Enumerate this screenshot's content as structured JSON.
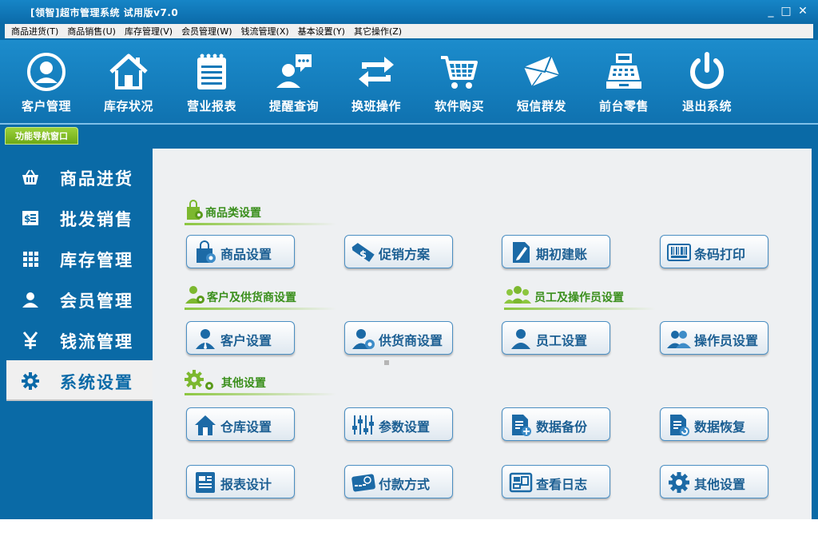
{
  "window": {
    "title": "[领智]超市管理系统 试用版v7.0",
    "minimize": "_",
    "maximize": "□",
    "close": "✕"
  },
  "menu": [
    "商品进货(T)",
    "商品销售(U)",
    "库存管理(V)",
    "会员管理(W)",
    "钱流管理(X)",
    "基本设置(Y)",
    "其它操作(Z)"
  ],
  "toolbar": [
    {
      "label": "客户管理",
      "icon": "user-circle-icon"
    },
    {
      "label": "库存状况",
      "icon": "house-icon"
    },
    {
      "label": "营业报表",
      "icon": "notepad-icon"
    },
    {
      "label": "提醒查询",
      "icon": "chat-user-icon"
    },
    {
      "label": "换班操作",
      "icon": "swap-arrows-icon"
    },
    {
      "label": "软件购买",
      "icon": "shopping-cart-icon"
    },
    {
      "label": "短信群发",
      "icon": "envelope-icon"
    },
    {
      "label": "前台零售",
      "icon": "cash-register-icon"
    },
    {
      "label": "退出系统",
      "icon": "power-icon"
    }
  ],
  "nav_tab": "功能导航窗口",
  "sidebar": [
    {
      "label": "商品进货",
      "icon": "basket-icon"
    },
    {
      "label": "批发销售",
      "icon": "invoice-icon"
    },
    {
      "label": "库存管理",
      "icon": "grid-icon"
    },
    {
      "label": "会员管理",
      "icon": "person-icon"
    },
    {
      "label": "钱流管理",
      "icon": "yen-icon"
    },
    {
      "label": "系统设置",
      "icon": "gear-icon",
      "active": true
    }
  ],
  "sections": {
    "goods": "商品类设置",
    "customer": "客户及供货商设置",
    "staff": "员工及操作员设置",
    "other": "其他设置"
  },
  "buttons": {
    "goods_settings": "商品设置",
    "promotion": "促销方案",
    "initial_accounts": "期初建账",
    "barcode_print": "条码打印",
    "customer_settings": "客户设置",
    "supplier_settings": "供货商设置",
    "employee_settings": "员工设置",
    "operator_settings": "操作员设置",
    "warehouse_settings": "仓库设置",
    "parameter_settings": "参数设置",
    "data_backup": "数据备份",
    "data_restore": "数据恢复",
    "report_design": "报表设计",
    "payment_methods": "付款方式",
    "view_log": "查看日志",
    "other_settings": "其他设置"
  },
  "colors": {
    "brand_blue": "#0a6aa6",
    "green_accent": "#8cc63f",
    "button_text": "#1c5f93"
  }
}
